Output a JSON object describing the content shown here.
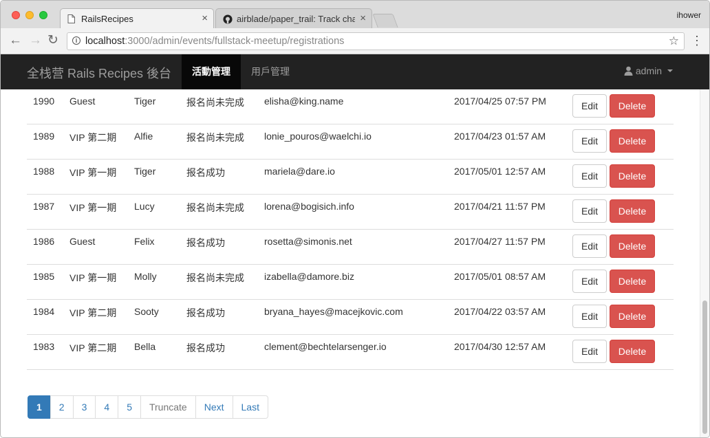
{
  "browser": {
    "tabs": [
      {
        "title": "RailsRecipes",
        "active": true
      },
      {
        "title": "airblade/paper_trail: Track cha",
        "active": false
      }
    ],
    "profile": "ihower",
    "url_host": "localhost",
    "url_rest": ":3000/admin/events/fullstack-meetup/registrations"
  },
  "navbar": {
    "brand": "全栈营 Rails Recipes 後台",
    "items": [
      {
        "label": "活動管理",
        "active": true
      },
      {
        "label": "用戶管理",
        "active": false
      }
    ],
    "user": "admin"
  },
  "table": {
    "rows": [
      {
        "id": "1990",
        "ticket": "Guest",
        "name": "Tiger",
        "status": "报名尚未完成",
        "email": "elisha@king.name",
        "created_at": "2017/04/25 07:57 PM"
      },
      {
        "id": "1989",
        "ticket": "VIP 第二期",
        "name": "Alfie",
        "status": "报名尚未完成",
        "email": "lonie_pouros@waelchi.io",
        "created_at": "2017/04/23 01:57 AM"
      },
      {
        "id": "1988",
        "ticket": "VIP 第一期",
        "name": "Tiger",
        "status": "报名成功",
        "email": "mariela@dare.io",
        "created_at": "2017/05/01 12:57 AM"
      },
      {
        "id": "1987",
        "ticket": "VIP 第一期",
        "name": "Lucy",
        "status": "报名尚未完成",
        "email": "lorena@bogisich.info",
        "created_at": "2017/04/21 11:57 PM"
      },
      {
        "id": "1986",
        "ticket": "Guest",
        "name": "Felix",
        "status": "报名成功",
        "email": "rosetta@simonis.net",
        "created_at": "2017/04/27 11:57 PM"
      },
      {
        "id": "1985",
        "ticket": "VIP 第一期",
        "name": "Molly",
        "status": "报名尚未完成",
        "email": "izabella@damore.biz",
        "created_at": "2017/05/01 08:57 AM"
      },
      {
        "id": "1984",
        "ticket": "VIP 第二期",
        "name": "Sooty",
        "status": "报名成功",
        "email": "bryana_hayes@macejkovic.com",
        "created_at": "2017/04/22 03:57 AM"
      },
      {
        "id": "1983",
        "ticket": "VIP 第二期",
        "name": "Bella",
        "status": "报名成功",
        "email": "clement@bechtelarsenger.io",
        "created_at": "2017/04/30 12:57 AM"
      }
    ],
    "edit_label": "Edit",
    "delete_label": "Delete"
  },
  "pagination": {
    "pages": [
      "1",
      "2",
      "3",
      "4",
      "5"
    ],
    "active_page": "1",
    "gap_label": "Truncate",
    "next_label": "Next",
    "last_label": "Last"
  },
  "colors": {
    "primary": "#337ab7",
    "danger": "#d9534f",
    "navbar": "#222222"
  }
}
